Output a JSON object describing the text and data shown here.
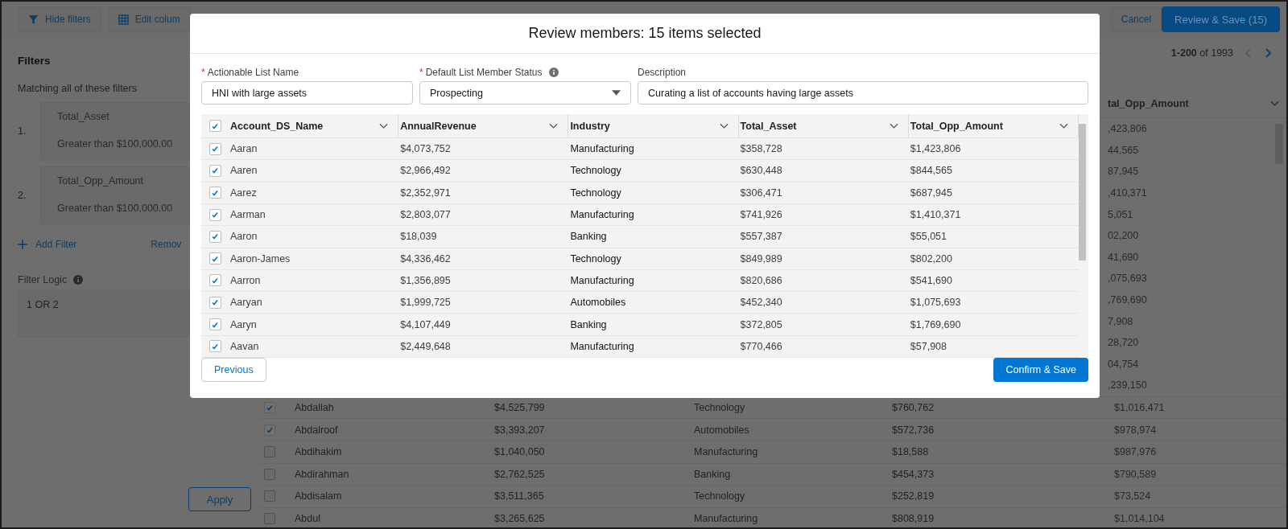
{
  "toolbar": {
    "left_buttons": [
      {
        "label": "Hide filters"
      },
      {
        "label": "Edit colum"
      }
    ],
    "cancel": "Cancel",
    "review_save": "Review & Save (15)"
  },
  "filters": {
    "title": "Filters",
    "matching": "Matching all of these filters",
    "items": [
      {
        "number": "1.",
        "field": "Total_Asset",
        "condition": "Greater than $100,000.00"
      },
      {
        "number": "2.",
        "field": "Total_Opp_Amount",
        "condition": "Greater than $100,000.00"
      }
    ],
    "add_filter": "Add Filter",
    "remove": "Remov",
    "logic_label": "Filter Logic",
    "logic_value": "1 OR 2",
    "apply": "Apply"
  },
  "pagination": {
    "range": "**1-200** of 1993"
  },
  "background_table": {
    "column_header": "tal_Opp_Amount",
    "partial_rows": [
      ",423,806",
      "44,565",
      "87,945",
      ",410,371",
      "5,051",
      "02,200",
      "41,690",
      ",075,693",
      ",769,690",
      "7,908",
      "28,720",
      "04,754",
      ",239,150"
    ],
    "rows": [
      {
        "checked": true,
        "cells": [
          "Abdallah",
          "$4,525,799",
          "Technology",
          "$760,762",
          "$1,016,471"
        ]
      },
      {
        "checked": true,
        "cells": [
          "Abdalroof",
          "$3,393,207",
          "Automobiles",
          "$572,736",
          "$978,974"
        ]
      },
      {
        "checked": false,
        "cells": [
          "Abdihakim",
          "$1,040,050",
          "Manufacturing",
          "$18,588",
          "$987,976"
        ]
      },
      {
        "checked": false,
        "cells": [
          "Abdirahman",
          "$2,762,525",
          "Banking",
          "$454,373",
          "$790,589"
        ]
      },
      {
        "checked": false,
        "cells": [
          "Abdisalam",
          "$3,511,365",
          "Technology",
          "$252,819",
          "$73,524"
        ]
      },
      {
        "checked": false,
        "cells": [
          "Abdul",
          "$3,265,625",
          "Manufacturing",
          "$808,919",
          "$1,014,104"
        ]
      }
    ]
  },
  "modal": {
    "title": "Review members: 15 items selected",
    "fields": [
      {
        "kind": "text",
        "label": "Actionable List Name",
        "required_mark": "*",
        "value": "HNI with large assets"
      },
      {
        "kind": "select",
        "label": "Default List Member Status",
        "required_mark": "*",
        "info": true,
        "value": "Prospecting"
      },
      {
        "kind": "text",
        "label": "Description",
        "value": "Curating a list of accounts having large assets"
      }
    ],
    "table": {
      "all_checked": true,
      "columns": [
        "Account_DS_Name",
        "AnnualRevenue",
        "Industry",
        "Total_Asset",
        "Total_Opp_Amount"
      ],
      "rows": [
        {
          "checked": true,
          "cells": [
            "Aaran",
            "$4,073,752",
            "Manufacturing",
            "$358,728",
            "$1,423,806"
          ]
        },
        {
          "checked": true,
          "cells": [
            "Aaren",
            "$2,966,492",
            "Technology",
            "$630,448",
            "$844,565"
          ]
        },
        {
          "checked": true,
          "cells": [
            "Aarez",
            "$2,352,971",
            "Technology",
            "$306,471",
            "$687,945"
          ]
        },
        {
          "checked": true,
          "cells": [
            "Aarman",
            "$2,803,077",
            "Manufacturing",
            "$741,926",
            "$1,410,371"
          ]
        },
        {
          "checked": true,
          "cells": [
            "Aaron",
            "$18,039",
            "Banking",
            "$557,387",
            "$55,051"
          ]
        },
        {
          "checked": true,
          "cells": [
            "Aaron-James",
            "$4,336,462",
            "Technology",
            "$849,989",
            "$802,200"
          ]
        },
        {
          "checked": true,
          "cells": [
            "Aarron",
            "$1,356,895",
            "Manufacturing",
            "$820,686",
            "$541,690"
          ]
        },
        {
          "checked": true,
          "cells": [
            "Aaryan",
            "$1,999,725",
            "Automobiles",
            "$452,340",
            "$1,075,693"
          ]
        },
        {
          "checked": true,
          "cells": [
            "Aaryn",
            "$4,107,449",
            "Banking",
            "$372,805",
            "$1,769,690"
          ]
        },
        {
          "checked": true,
          "cells": [
            "Aavan",
            "$2,449,648",
            "Manufacturing",
            "$770,466",
            "$57,908"
          ]
        }
      ]
    },
    "previous": "Previous",
    "confirm": "Confirm & Save"
  }
}
